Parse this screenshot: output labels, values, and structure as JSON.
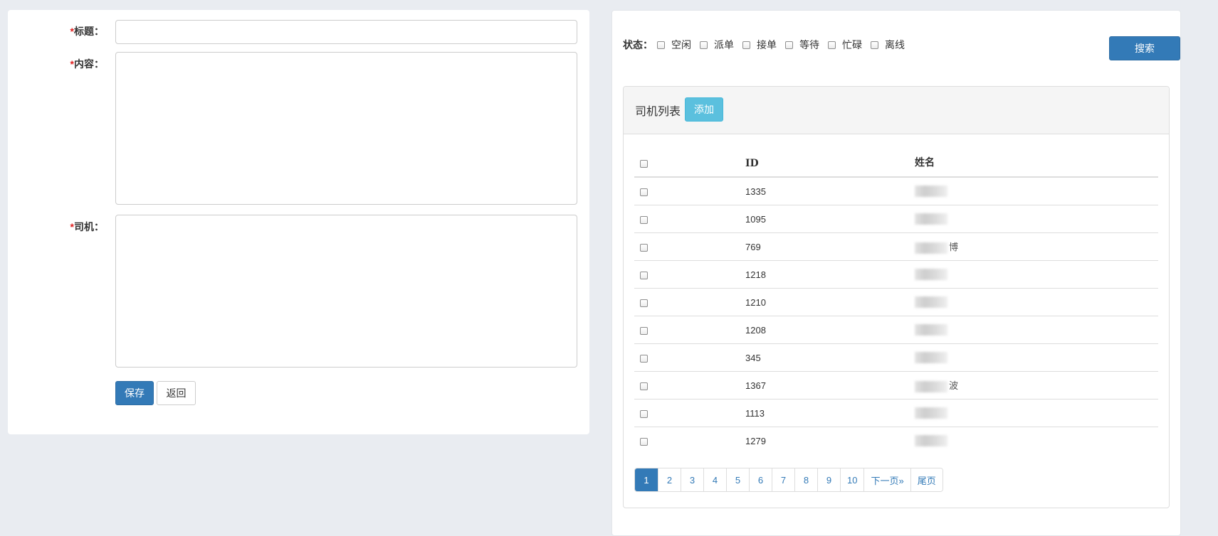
{
  "form": {
    "required_mark": "*",
    "title_label": "标题：",
    "content_label": "内容：",
    "driver_label": "司机：",
    "title_value": "",
    "content_value": "",
    "driver_value": "",
    "save_label": "保存",
    "back_label": "返回"
  },
  "filter": {
    "status_label": "状态：",
    "statuses": [
      "空闲",
      "派单",
      "接单",
      "等待",
      "忙碌",
      "离线"
    ],
    "search_label": "搜索"
  },
  "driver_list": {
    "title": "司机列表",
    "add_label": "添加",
    "columns": [
      "ID",
      "姓名"
    ],
    "rows": [
      {
        "id": "1335",
        "name": ""
      },
      {
        "id": "1095",
        "name": ""
      },
      {
        "id": "769",
        "name": "博"
      },
      {
        "id": "1218",
        "name": ""
      },
      {
        "id": "1210",
        "name": ""
      },
      {
        "id": "1208",
        "name": ""
      },
      {
        "id": "345",
        "name": ""
      },
      {
        "id": "1367",
        "name": "波"
      },
      {
        "id": "1113",
        "name": ""
      },
      {
        "id": "1279",
        "name": ""
      }
    ]
  },
  "pagination": {
    "pages": [
      "1",
      "2",
      "3",
      "4",
      "5",
      "6",
      "7",
      "8",
      "9",
      "10"
    ],
    "current": "1",
    "next_label": "下一页»",
    "last_label": "尾页"
  },
  "colors": {
    "primary": "#337ab7",
    "info": "#5bc0de",
    "required": "#e02020",
    "background": "#e9ecf1"
  }
}
